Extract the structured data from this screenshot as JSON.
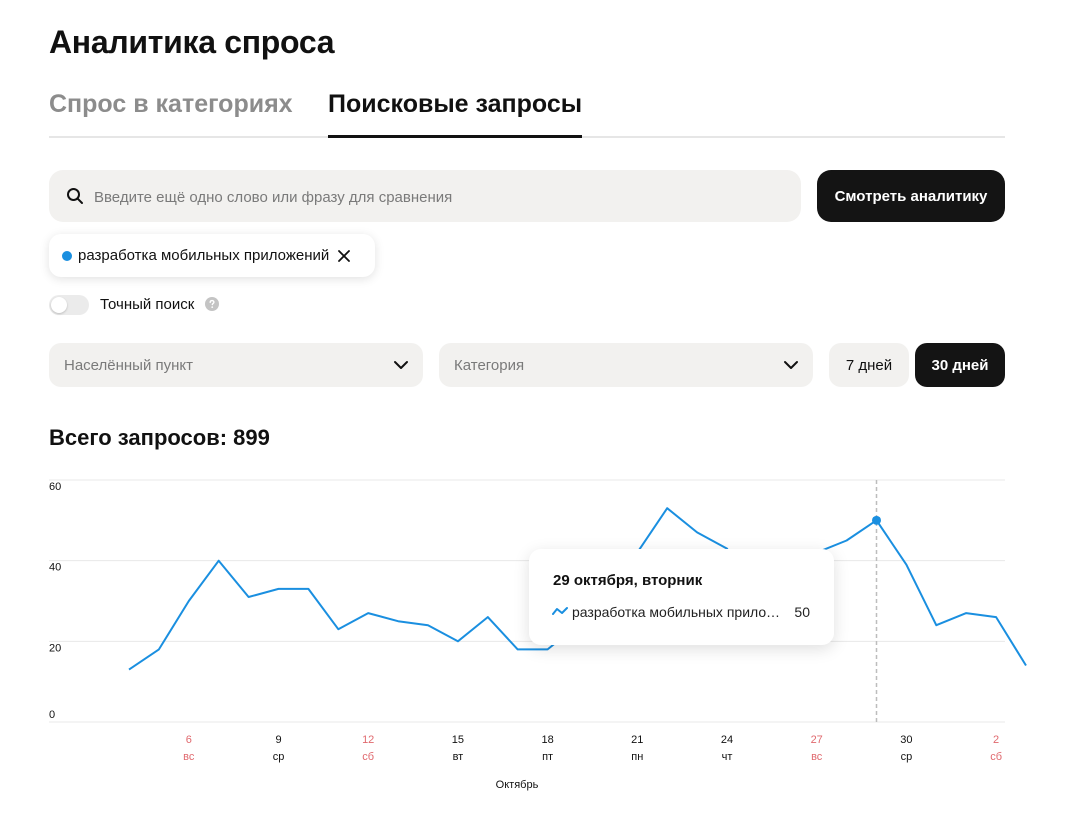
{
  "page": {
    "title": "Аналитика спроса"
  },
  "tabs": [
    {
      "label": "Спрос в категориях",
      "active": false
    },
    {
      "label": "Поисковые запросы",
      "active": true
    }
  ],
  "search": {
    "placeholder": "Введите ещё одно слово или фразу для сравнения",
    "value": "",
    "button_label": "Смотреть аналитику"
  },
  "chips": [
    {
      "label": "разработка мобильных приложений",
      "color": "#1a8fe0"
    }
  ],
  "exact_search": {
    "label": "Точный поиск",
    "enabled": false
  },
  "filters": {
    "city_placeholder": "Населённый пункт",
    "category_placeholder": "Категория",
    "periods": [
      "7 дней",
      "30 дней"
    ],
    "active_period": "30 дней"
  },
  "total": {
    "label": "Всего запросов: 899"
  },
  "tooltip": {
    "title": "29 октября, вторник",
    "series": "разработка мобильных приложений",
    "value": "50"
  },
  "chart_data": {
    "type": "line",
    "x": [
      "2024-10-04",
      "2024-10-05",
      "2024-10-06",
      "2024-10-07",
      "2024-10-08",
      "2024-10-09",
      "2024-10-10",
      "2024-10-11",
      "2024-10-12",
      "2024-10-13",
      "2024-10-14",
      "2024-10-15",
      "2024-10-16",
      "2024-10-17",
      "2024-10-18",
      "2024-10-19",
      "2024-10-20",
      "2024-10-21",
      "2024-10-22",
      "2024-10-23",
      "2024-10-24",
      "2024-10-25",
      "2024-10-26",
      "2024-10-27",
      "2024-10-28",
      "2024-10-29",
      "2024-10-30",
      "2024-10-31",
      "2024-11-01",
      "2024-11-02",
      "2024-11-03"
    ],
    "series": [
      {
        "name": "разработка мобильных приложений",
        "color": "#1a8fe0",
        "values": [
          13,
          18,
          30,
          40,
          31,
          33,
          33,
          23,
          27,
          25,
          24,
          20,
          26,
          18,
          18,
          24,
          32,
          42,
          53,
          47,
          43,
          30,
          36,
          42,
          45,
          50,
          39,
          24,
          27,
          26,
          14
        ]
      }
    ],
    "xlabel": "Октябрь",
    "ylabel": "",
    "ylim": [
      0,
      60
    ],
    "yticks": [
      0,
      20,
      40,
      60
    ],
    "xticks": [
      {
        "day": "6",
        "weekday": "вс",
        "weekend": true
      },
      {
        "day": "9",
        "weekday": "ср",
        "weekend": false
      },
      {
        "day": "12",
        "weekday": "сб",
        "weekend": true
      },
      {
        "day": "15",
        "weekday": "вт",
        "weekend": false
      },
      {
        "day": "18",
        "weekday": "пт",
        "weekend": false
      },
      {
        "day": "21",
        "weekday": "пн",
        "weekend": false
      },
      {
        "day": "24",
        "weekday": "чт",
        "weekend": false
      },
      {
        "day": "27",
        "weekday": "вс",
        "weekend": true
      },
      {
        "day": "30",
        "weekday": "ср",
        "weekend": false
      },
      {
        "day": "2",
        "weekday": "сб",
        "weekend": true
      }
    ],
    "highlight_x": "2024-10-29",
    "grid": true,
    "colors": {
      "weekend": "#e0696e",
      "weekday": "#111111",
      "grid": "#e8e8e8",
      "crosshair": "#bdbdbd"
    }
  }
}
